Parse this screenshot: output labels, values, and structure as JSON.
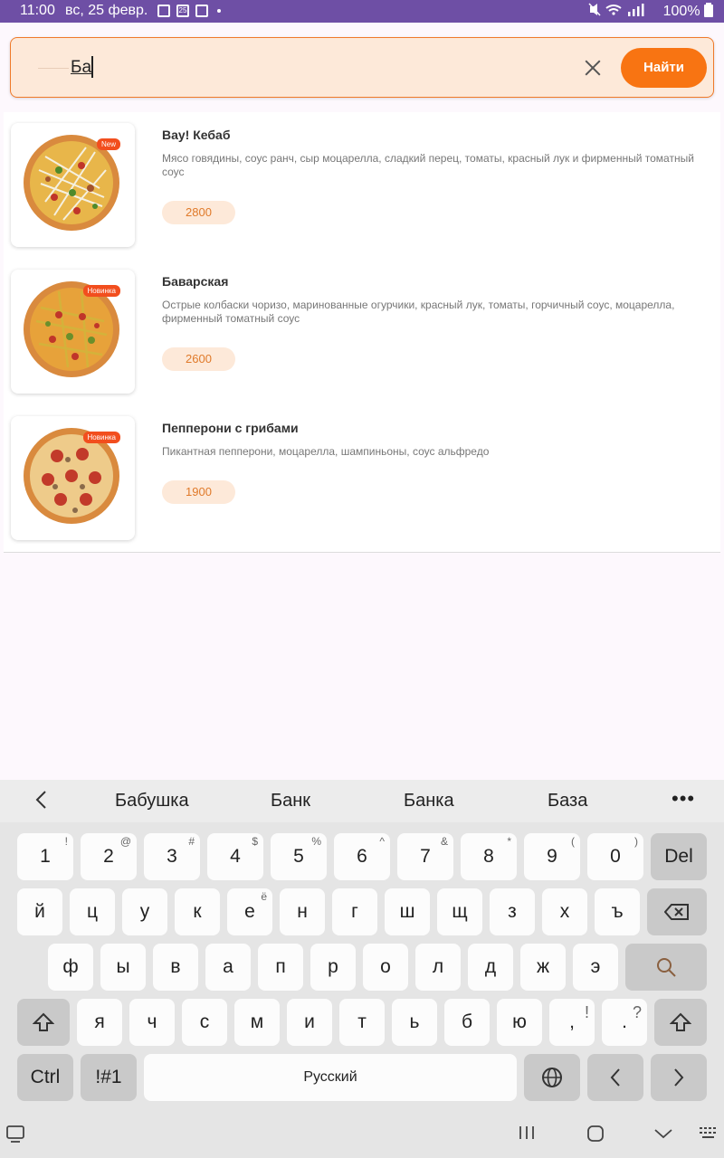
{
  "status_bar": {
    "time": "11:00",
    "date": "вс, 25 февр.",
    "calendar_day": "25",
    "battery": "100%"
  },
  "search": {
    "value": "Ба",
    "find_label": "Найти"
  },
  "products": [
    {
      "title": "Вау! Кебаб",
      "description": "Мясо говядины, соус ранч, сыр моцарелла, сладкий перец, томаты, красный лук и фирменный томатный соус",
      "price": "2800",
      "badge": "New"
    },
    {
      "title": "Баварская",
      "description": "Острые колбаски чоризо, маринованные огурчики, красный лук, томаты, горчичный соус, моцарелла, фирменный томатный соус",
      "price": "2600",
      "badge": "Новинка"
    },
    {
      "title": "Пепперони с грибами",
      "description": "Пикантная пепперони, моцарелла, шампиньоны, соус альфредо",
      "price": "1900",
      "badge": "Новинка"
    }
  ],
  "keyboard": {
    "suggestions": [
      "Бабушка",
      "Банк",
      "Банка",
      "База"
    ],
    "number_row": [
      "1",
      "2",
      "3",
      "4",
      "5",
      "6",
      "7",
      "8",
      "9",
      "0"
    ],
    "number_symbols": [
      "!",
      "@",
      "#",
      "$",
      "%",
      "^",
      "&",
      "*",
      "(",
      ")"
    ],
    "del_label": "Del",
    "row1": [
      "й",
      "ц",
      "у",
      "к",
      "е",
      "н",
      "г",
      "ш",
      "щ",
      "з",
      "х",
      "ъ"
    ],
    "e_alt": "ё",
    "row2": [
      "ф",
      "ы",
      "в",
      "а",
      "п",
      "р",
      "о",
      "л",
      "д",
      "ж",
      "э"
    ],
    "row3": [
      "я",
      "ч",
      "с",
      "м",
      "и",
      "т",
      "ь",
      "б",
      "ю"
    ],
    "comma": ",",
    "comma_alt": "!",
    "period": ".",
    "period_alt": "?",
    "ctrl_label": "Ctrl",
    "symbols_label": "!#1",
    "space_label": "Русский"
  }
}
